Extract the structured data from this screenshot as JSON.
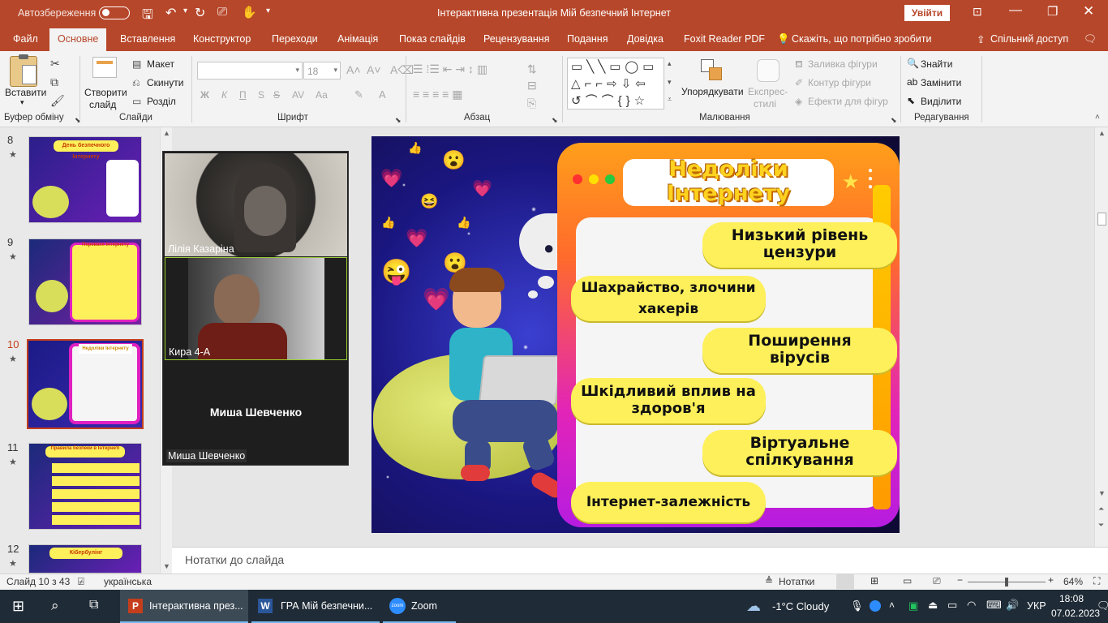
{
  "titlebar": {
    "autosave_label": "Автозбереження",
    "autosave_state": "off",
    "doc_title": "Інтерактивна презентація Мій безпечний Інтернет",
    "signin_button": "Увійти"
  },
  "ribbon_tabs": [
    "Файл",
    "Основне",
    "Вставлення",
    "Конструктор",
    "Переходи",
    "Анімація",
    "Показ слайдів",
    "Рецензування",
    "Подання",
    "Довідка",
    "Foxit Reader PDF"
  ],
  "tell_me": "Скажіть, що потрібно зробити",
  "share": "Спільний доступ",
  "ribbon": {
    "clipboard": {
      "paste": "Вставити",
      "group": "Буфер обміну"
    },
    "slides": {
      "new_slide_1": "Створити",
      "new_slide_2": "слайд",
      "layout": "Макет",
      "reset": "Скинути",
      "section": "Розділ",
      "group": "Слайди"
    },
    "font": {
      "font_name": "",
      "font_size": "18",
      "bold": "Ж",
      "italic": "К",
      "underline": "П",
      "strike": "S",
      "spacing": "AV",
      "case": "Аа",
      "group": "Шрифт"
    },
    "paragraph": {
      "group": "Абзац"
    },
    "drawing": {
      "arrange": "Упорядкувати",
      "quick_styles_1": "Експрес-",
      "quick_styles_2": "стилі",
      "shape_fill": "Заливка фігури",
      "shape_outline": "Контур фігури",
      "shape_effects": "Ефекти для фігур",
      "group": "Малювання"
    },
    "editing": {
      "find": "Знайти",
      "replace": "Замінити",
      "select": "Виділити",
      "group": "Редагування"
    }
  },
  "thumbnails": [
    {
      "num": "8",
      "title": "День безпечного Інтернету"
    },
    {
      "num": "9",
      "title": "Переваги Інтернету"
    },
    {
      "num": "10",
      "title": "Недоліки Інтернету",
      "selected": true
    },
    {
      "num": "11",
      "title": "Правила безпеки в Інтернеті"
    },
    {
      "num": "12",
      "title": "Кібербулінг"
    }
  ],
  "zoom_panel": {
    "p1": "Лілія Казаріна",
    "p2": "Кира 4-А",
    "p3_center": "Миша Шевченко",
    "p3_label": "Миша Шевченко"
  },
  "slide": {
    "title_line1": "Недоліки",
    "title_line2": "Інтернету",
    "bubbles": [
      {
        "line1": "Низький рівень",
        "line2": "цензури"
      },
      {
        "line1": "Шахрайство, злочини",
        "line2": "хакерів"
      },
      {
        "line1": "Поширення",
        "line2": "вірусів"
      },
      {
        "line1": "Шкідливий вплив на",
        "line2": "здоров'я"
      },
      {
        "line1": "Віртуальне",
        "line2": "спілкування"
      },
      {
        "line1": "Інтернет-залежність",
        "line2": ""
      }
    ]
  },
  "notes_placeholder": "Нотатки до слайда",
  "status": {
    "slide_of": "Слайд 10 з 43",
    "language": "українська",
    "notes_btn": "Нотатки",
    "zoom_pct": "64%",
    "zoom_level": 0.64
  },
  "taskbar": {
    "apps": [
      {
        "label": "Інтерактивна през..."
      },
      {
        "label": "ГРА Мій безпечни..."
      },
      {
        "label": "Zoom"
      }
    ],
    "weather": "-1°C  Cloudy",
    "lang": "УКР",
    "time": "18:08",
    "date": "07.02.2023"
  },
  "colors": {
    "accent": "#b7472a",
    "slide_bg": "#1a1680",
    "bubble": "#fdf05a",
    "frame_magenta": "#e020c0",
    "frame_orange": "#ff8a1c"
  }
}
